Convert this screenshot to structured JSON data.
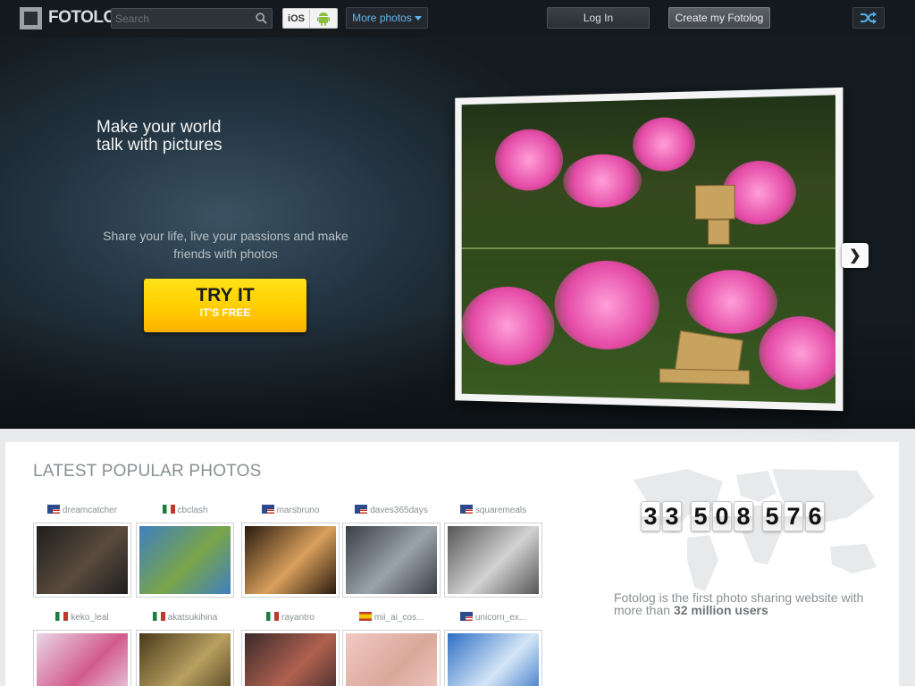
{
  "brand": {
    "name": "FOTOLOG"
  },
  "topbar": {
    "search_placeholder": "Search",
    "apps": [
      {
        "label": "iOS",
        "icon": "apple-icon"
      },
      {
        "label": "",
        "icon": "android-icon"
      }
    ],
    "more_photos": "More photos",
    "login": "Log In",
    "create": "Create my Fotolog",
    "shuffle_icon": "shuffle-icon"
  },
  "hero": {
    "title": "Make your world\ntalk with pictures",
    "subtitle": "Share your life, live your passions and make friends with photos",
    "cta_main": "TRY IT",
    "cta_sub": "IT'S FREE",
    "next_arrow": "❯"
  },
  "popular": {
    "title": "LATEST POPULAR PHOTOS",
    "items": [
      {
        "user": "dreamcatcher",
        "flag": "us"
      },
      {
        "user": "cbclash",
        "flag": "mx"
      },
      {
        "user": "marsbruno",
        "flag": "us"
      },
      {
        "user": "daves365days",
        "flag": "us"
      },
      {
        "user": "squaremeals",
        "flag": "us"
      },
      {
        "user": "keko_leal",
        "flag": "mx"
      },
      {
        "user": "akatsukihina",
        "flag": "mx"
      },
      {
        "user": "rayantro",
        "flag": "mx"
      },
      {
        "user": "mii_ai_cos...",
        "flag": "es"
      },
      {
        "user": "unicorn_ex...",
        "flag": "us"
      }
    ]
  },
  "stats": {
    "counter_groups": [
      "33",
      "508",
      "576"
    ],
    "tagline_prefix": "Fotolog is the first photo sharing website with more than ",
    "tagline_bold": "32 million users"
  },
  "colors": {
    "accent_blue": "#5fb6ef",
    "cta_yellow": "#ffd000",
    "topbar_bg": "#14191d"
  }
}
